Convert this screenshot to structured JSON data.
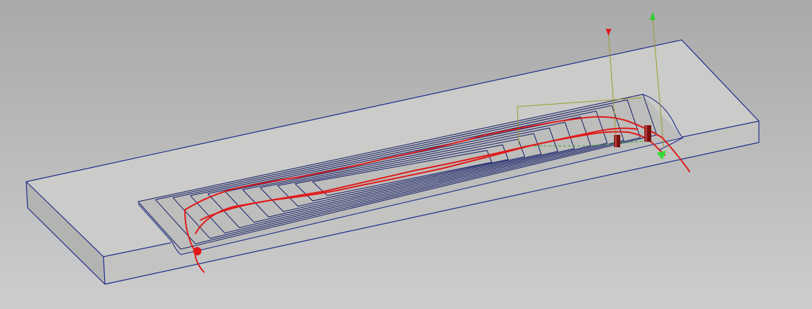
{
  "viewport": {
    "background_top": "#a9a9a9",
    "background_bottom": "#cdcdcd"
  },
  "model": {
    "top_face_color": "#cbcbc9",
    "front_face_color": "#c3c3c1",
    "side_face_color": "#b3b3b1",
    "edge_color": "#1a2a8c",
    "pocket_wall_color": "#bdbdbb"
  },
  "toolpaths": {
    "offset_color": "#101a66",
    "lead_color": "#e01818",
    "link_color": "#9a9a2a",
    "rapid_color": "#2fa52f"
  },
  "markers": {
    "start_point_color": "#e01818",
    "tool_holder_color": "#7a1010",
    "axis_up_color": "#2ecc2e",
    "axis_down_color": "#e01818",
    "axis_line_color": "#a8a830",
    "direction_arrow_color": "#33dd33"
  }
}
